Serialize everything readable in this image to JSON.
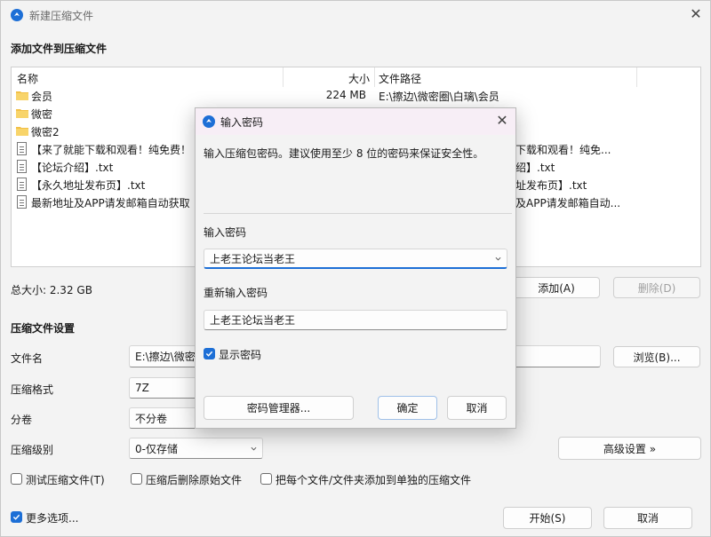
{
  "main": {
    "title": "新建压缩文件",
    "add_section": "添加文件到压缩文件",
    "columns": {
      "name": "名称",
      "size": "大小",
      "path": "文件路径"
    },
    "files": [
      {
        "type": "folder",
        "name": "会员",
        "size": "224 MB",
        "path": "E:\\擦边\\微密圈\\白璃\\会员"
      },
      {
        "type": "folder",
        "name": "微密",
        "size": "",
        "path": ""
      },
      {
        "type": "folder",
        "name": "微密2",
        "size": "",
        "path": ""
      },
      {
        "type": "file",
        "name": "【来了就能下载和观看！纯免费！",
        "size": "",
        "path": "能下载和观看！纯免..."
      },
      {
        "type": "file",
        "name": "【论坛介绍】.txt",
        "size": "",
        "path": "介绍】.txt"
      },
      {
        "type": "file",
        "name": "【永久地址发布页】.txt",
        "size": "",
        "path": "地址发布页】.txt"
      },
      {
        "type": "file",
        "name": "最新地址及APP请发邮箱自动获取",
        "size": "",
        "path": "止及APP请发邮箱自动..."
      }
    ],
    "total_size": "总大小: 2.32 GB",
    "add_button": "添加(A)",
    "remove_button": "删除(D)",
    "settings_section": "压缩文件设置",
    "filename_label": "文件名",
    "filename_value": "E:\\擦边\\微密圈\\",
    "browse_button": "浏览(B)...",
    "format_label": "压缩格式",
    "format_value": "7Z",
    "split_label": "分卷",
    "split_value": "不分卷",
    "level_label": "压缩级别",
    "level_value": "0-仅存储",
    "advanced_button": "高级设置 »",
    "test_check": "测试压缩文件(T)",
    "delete_check": "压缩后删除原始文件",
    "separate_check": "把每个文件/文件夹添加到单独的压缩文件",
    "more_options": "更多选项...",
    "start_button": "开始(S)",
    "cancel_button": "取消"
  },
  "dialog": {
    "title": "输入密码",
    "description": "输入压缩包密码。建议使用至少 8 位的密码来保证安全性。",
    "password_label": "输入密码",
    "password_value": "上老王论坛当老王",
    "confirm_label": "重新输入密码",
    "confirm_value": "上老王论坛当老王",
    "show_password": "显示密码",
    "manager_button": "密码管理器...",
    "ok_button": "确定",
    "cancel_button": "取消"
  },
  "colors": {
    "accent": "#1d6fd6",
    "folder": "#f2c046",
    "dialog_title_bg": "#f7eef6"
  }
}
